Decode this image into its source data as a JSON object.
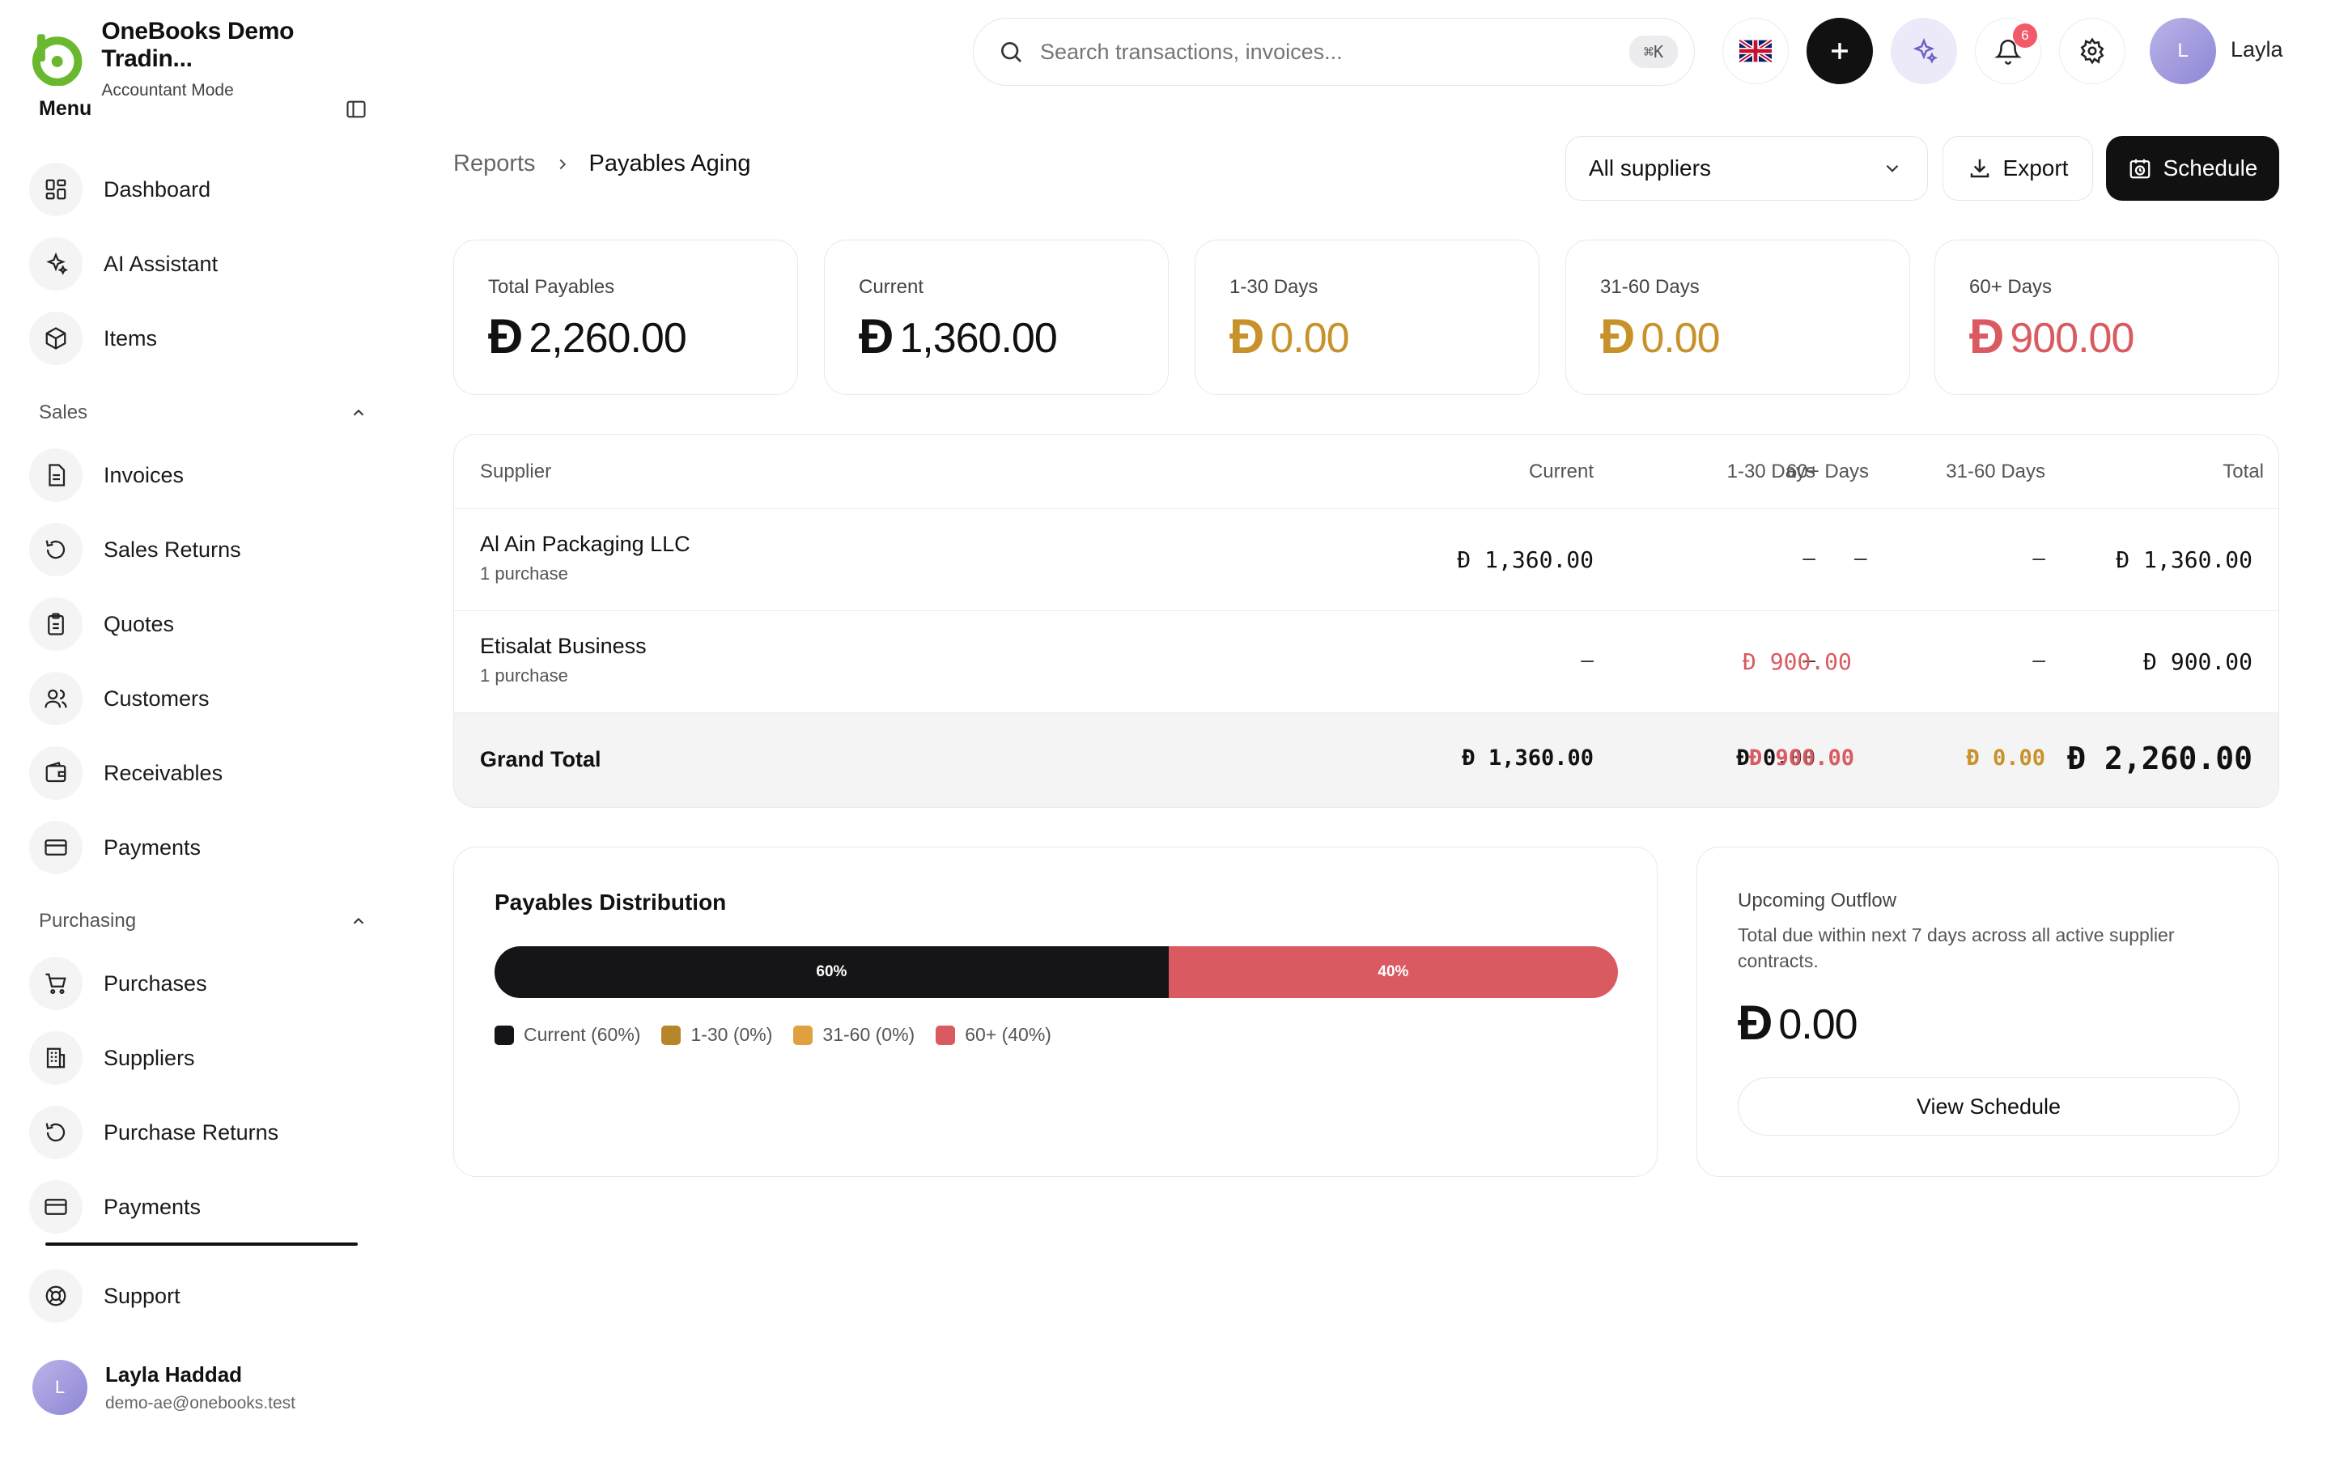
{
  "brand": {
    "name": "OneBooks Demo Tradin...",
    "mode": "Accountant Mode"
  },
  "sidebar": {
    "menu_title": "Menu",
    "items": [
      {
        "label": "Dashboard"
      },
      {
        "label": "AI Assistant"
      },
      {
        "label": "Items"
      }
    ],
    "sales": {
      "label": "Sales",
      "items": [
        {
          "label": "Invoices"
        },
        {
          "label": "Sales Returns"
        },
        {
          "label": "Quotes"
        },
        {
          "label": "Customers"
        },
        {
          "label": "Receivables"
        },
        {
          "label": "Payments"
        }
      ]
    },
    "purchasing": {
      "label": "Purchasing",
      "items": [
        {
          "label": "Purchases"
        },
        {
          "label": "Suppliers"
        },
        {
          "label": "Purchase Returns"
        },
        {
          "label": "Payments"
        }
      ]
    },
    "support": "Support",
    "user": {
      "initial": "L",
      "name": "Layla Haddad",
      "email": "demo-ae@onebooks.test"
    }
  },
  "topbar": {
    "search_placeholder": "Search transactions, invoices...",
    "shortcut": "⌘K",
    "notifications_count": "6",
    "user_initial": "L",
    "user_name": "Layla"
  },
  "header": {
    "crumb_parent": "Reports",
    "crumb_current": "Payables Aging",
    "supplier_filter": "All suppliers",
    "export_label": "Export",
    "schedule_label": "Schedule"
  },
  "currency": "Ð",
  "summary": [
    {
      "label": "Total Payables",
      "value": "2,260.00"
    },
    {
      "label": "Current",
      "value": "1,360.00"
    },
    {
      "label": "1-30 Days",
      "value": "0.00"
    },
    {
      "label": "31-60 Days",
      "value": "0.00"
    },
    {
      "label": "60+ Days",
      "value": "900.00"
    }
  ],
  "table": {
    "headers": [
      "Supplier",
      "Current",
      "1-30 Days",
      "31-60 Days",
      "60+ Days",
      "Total"
    ],
    "dash": "–",
    "rows": [
      {
        "supplier": "Al Ain Packaging LLC",
        "sub": "1 purchase",
        "current": "1,360.00",
        "total": "1,360.00"
      },
      {
        "supplier": "Etisalat Business",
        "sub": "1 purchase",
        "d60": "900.00",
        "total": "900.00"
      }
    ],
    "grand": {
      "label": "Grand Total",
      "current": "1,360.00",
      "d30": "0.00",
      "d3160": "0.00",
      "d60": "900.00",
      "total": "2,260.00"
    }
  },
  "distribution": {
    "title": "Payables Distribution",
    "segments": [
      {
        "label": "60%",
        "percent": 60,
        "color": "#151517"
      },
      {
        "label": "40%",
        "percent": 40,
        "color": "#d95a60"
      }
    ],
    "legend": [
      {
        "label": "Current (60%)",
        "color": "#151517"
      },
      {
        "label": "1-30 (0%)",
        "color": "#b8862a"
      },
      {
        "label": "31-60 (0%)",
        "color": "#e0a040"
      },
      {
        "label": "60+ (40%)",
        "color": "#d95a60"
      }
    ]
  },
  "upcoming": {
    "title": "Upcoming Outflow",
    "description": "Total due within next 7 days across all active supplier contracts.",
    "value": "0.00",
    "button": "View Schedule"
  },
  "colors": {
    "accent_green": "#6ab82e",
    "amber": "#c8922a",
    "red": "#d95a60",
    "dark": "#111111"
  }
}
